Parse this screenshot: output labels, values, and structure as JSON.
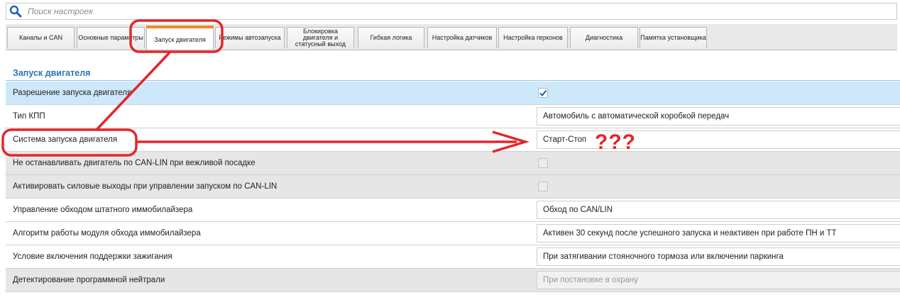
{
  "search": {
    "placeholder": "Поиск настроек",
    "icon": "search-icon"
  },
  "tabs": [
    {
      "label": "Каналы и CAN",
      "active": false
    },
    {
      "label": "Основные параметры",
      "active": false
    },
    {
      "label": "Запуск двигателя",
      "active": true
    },
    {
      "label": "Режимы автозапуска",
      "active": false
    },
    {
      "label": "Блокировка\nдвигателя и\nстатусный выход",
      "active": false
    },
    {
      "label": "Гибкая логика",
      "active": false
    },
    {
      "label": "Настройка датчиков",
      "active": false
    },
    {
      "label": "Настройка герконов",
      "active": false
    },
    {
      "label": "Диагностика",
      "active": false
    },
    {
      "label": "Памятка установщика",
      "active": false
    }
  ],
  "section": {
    "title": "Запуск двигателя"
  },
  "rows": [
    {
      "label": "Разрешение запуска двигателя",
      "type": "checkbox",
      "checked": true
    },
    {
      "label": "Тип КПП",
      "type": "select",
      "value": "Автомобиль с автоматической коробкой передач"
    },
    {
      "label": "Система запуска двигателя",
      "type": "select",
      "value": "Старт-Стоп"
    },
    {
      "label": "Не останавливать двигатель по CAN-LIN при вежливой посадке",
      "type": "checkbox",
      "checked": false,
      "disabled": true
    },
    {
      "label": "Активировать силовые выходы при управлении запуском по CAN-LIN",
      "type": "checkbox",
      "checked": false,
      "disabled": true
    },
    {
      "label": "Управление обходом штатного иммобилайзера",
      "type": "select",
      "value": "Обход по CAN/LIN"
    },
    {
      "label": "Алгоритм работы модуля обхода иммобилайзера",
      "type": "select",
      "value": "Активен 30 секунд после успешного запуска и неактивен при работе ПН и ТТ"
    },
    {
      "label": "Условие включения поддержки зажигания",
      "type": "select",
      "value": "При затягивании стояночного тормоза или включении паркинга"
    },
    {
      "label": "Детектирование программной нейтрали",
      "type": "select",
      "value": "При постановке в охрану",
      "disabled": true
    }
  ],
  "annotation": {
    "text": "???",
    "color": "#e3262b"
  },
  "colors": {
    "accent_tab": "#f08a24",
    "section_title": "#2e73b3",
    "selected_row": "#cde8fb",
    "annotation": "#e3262b"
  }
}
